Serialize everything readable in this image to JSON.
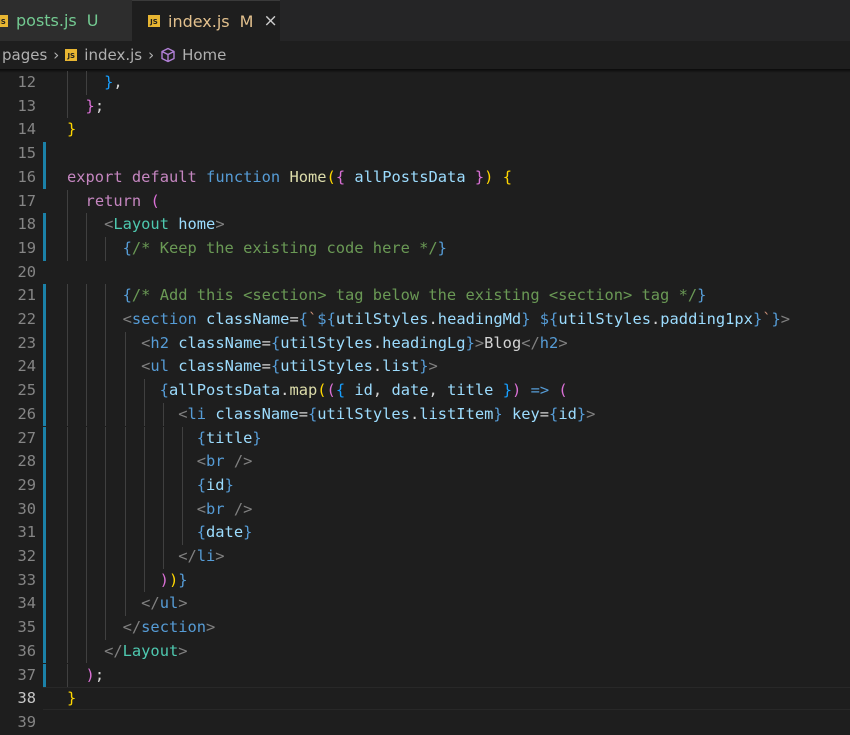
{
  "tabs": [
    {
      "label": "posts.js",
      "status": "U",
      "active": false
    },
    {
      "label": "index.js",
      "status": "M",
      "active": true
    }
  ],
  "breadcrumb": {
    "folder": "pages",
    "file": "index.js",
    "symbol": "Home"
  },
  "icons": {
    "file_badge": "JS",
    "close": "×",
    "chevron": "›"
  },
  "colors": {
    "git_untracked": "#73c991",
    "git_modified": "#e2c08d",
    "modified_gutter": "#1b81a8"
  },
  "editor": {
    "active_line": 38,
    "lines": [
      {
        "n": "12",
        "modified": false
      },
      {
        "n": "13",
        "modified": false
      },
      {
        "n": "14",
        "modified": false
      },
      {
        "n": "15",
        "modified": true
      },
      {
        "n": "16",
        "modified": true
      },
      {
        "n": "17",
        "modified": false
      },
      {
        "n": "18",
        "modified": true
      },
      {
        "n": "19",
        "modified": true
      },
      {
        "n": "20",
        "modified": false
      },
      {
        "n": "21",
        "modified": true
      },
      {
        "n": "22",
        "modified": true
      },
      {
        "n": "23",
        "modified": true
      },
      {
        "n": "24",
        "modified": true
      },
      {
        "n": "25",
        "modified": true
      },
      {
        "n": "26",
        "modified": true
      },
      {
        "n": "27",
        "modified": true
      },
      {
        "n": "28",
        "modified": true
      },
      {
        "n": "29",
        "modified": true
      },
      {
        "n": "30",
        "modified": true
      },
      {
        "n": "31",
        "modified": true
      },
      {
        "n": "32",
        "modified": true
      },
      {
        "n": "33",
        "modified": true
      },
      {
        "n": "34",
        "modified": true
      },
      {
        "n": "35",
        "modified": true
      },
      {
        "n": "36",
        "modified": true
      },
      {
        "n": "37",
        "modified": true
      },
      {
        "n": "38",
        "modified": false
      },
      {
        "n": "39",
        "modified": false
      }
    ],
    "code": [
      [
        [
          "p",
          "    "
        ],
        [
          "b3",
          "}"
        ],
        [
          "p",
          ","
        ]
      ],
      [
        [
          "p",
          "  "
        ],
        [
          "b2",
          "}"
        ],
        [
          "p",
          ";"
        ]
      ],
      [
        [
          "b1",
          "}"
        ]
      ],
      [],
      [
        [
          "kc",
          "export"
        ],
        [
          "p",
          " "
        ],
        [
          "kc",
          "default"
        ],
        [
          "p",
          " "
        ],
        [
          "k",
          "function"
        ],
        [
          "p",
          " "
        ],
        [
          "f",
          "Home"
        ],
        [
          "b1",
          "("
        ],
        [
          "b2",
          "{"
        ],
        [
          "p",
          " "
        ],
        [
          "v",
          "allPostsData"
        ],
        [
          "p",
          " "
        ],
        [
          "b2",
          "}"
        ],
        [
          "b1",
          ")"
        ],
        [
          "p",
          " "
        ],
        [
          "b1",
          "{"
        ]
      ],
      [
        [
          "p",
          "  "
        ],
        [
          "kc",
          "return"
        ],
        [
          "p",
          " "
        ],
        [
          "b2",
          "("
        ]
      ],
      [
        [
          "p",
          "    "
        ],
        [
          "t",
          "<"
        ],
        [
          "cmp",
          "Layout"
        ],
        [
          "p",
          " "
        ],
        [
          "a",
          "home"
        ],
        [
          "t",
          ">"
        ]
      ],
      [
        [
          "p",
          "      "
        ],
        [
          "k",
          "{"
        ],
        [
          "c",
          "/* Keep the existing code here */"
        ],
        [
          "k",
          "}"
        ]
      ],
      [],
      [
        [
          "p",
          "      "
        ],
        [
          "k",
          "{"
        ],
        [
          "c",
          "/* Add this <section> tag below the existing <section> tag */"
        ],
        [
          "k",
          "}"
        ]
      ],
      [
        [
          "p",
          "      "
        ],
        [
          "t",
          "<"
        ],
        [
          "tn",
          "section"
        ],
        [
          "p",
          " "
        ],
        [
          "a",
          "className"
        ],
        [
          "p",
          "="
        ],
        [
          "k",
          "{"
        ],
        [
          "s",
          "`"
        ],
        [
          "k",
          "${"
        ],
        [
          "v",
          "utilStyles"
        ],
        [
          "p",
          "."
        ],
        [
          "v",
          "headingMd"
        ],
        [
          "k",
          "}"
        ],
        [
          "s",
          " "
        ],
        [
          "k",
          "${"
        ],
        [
          "v",
          "utilStyles"
        ],
        [
          "p",
          "."
        ],
        [
          "v",
          "padding1px"
        ],
        [
          "k",
          "}"
        ],
        [
          "s",
          "`"
        ],
        [
          "k",
          "}"
        ],
        [
          "t",
          ">"
        ]
      ],
      [
        [
          "p",
          "        "
        ],
        [
          "t",
          "<"
        ],
        [
          "tn",
          "h2"
        ],
        [
          "p",
          " "
        ],
        [
          "a",
          "className"
        ],
        [
          "p",
          "="
        ],
        [
          "k",
          "{"
        ],
        [
          "v",
          "utilStyles"
        ],
        [
          "p",
          "."
        ],
        [
          "v",
          "headingLg"
        ],
        [
          "k",
          "}"
        ],
        [
          "t",
          ">"
        ],
        [
          "p",
          "Blog"
        ],
        [
          "t",
          "</"
        ],
        [
          "tn",
          "h2"
        ],
        [
          "t",
          ">"
        ]
      ],
      [
        [
          "p",
          "        "
        ],
        [
          "t",
          "<"
        ],
        [
          "tn",
          "ul"
        ],
        [
          "p",
          " "
        ],
        [
          "a",
          "className"
        ],
        [
          "p",
          "="
        ],
        [
          "k",
          "{"
        ],
        [
          "v",
          "utilStyles"
        ],
        [
          "p",
          "."
        ],
        [
          "v",
          "list"
        ],
        [
          "k",
          "}"
        ],
        [
          "t",
          ">"
        ]
      ],
      [
        [
          "p",
          "          "
        ],
        [
          "k",
          "{"
        ],
        [
          "v",
          "allPostsData"
        ],
        [
          "p",
          "."
        ],
        [
          "f",
          "map"
        ],
        [
          "b1",
          "("
        ],
        [
          "b2",
          "("
        ],
        [
          "b3",
          "{"
        ],
        [
          "p",
          " "
        ],
        [
          "v",
          "id"
        ],
        [
          "p",
          ", "
        ],
        [
          "v",
          "date"
        ],
        [
          "p",
          ", "
        ],
        [
          "v",
          "title"
        ],
        [
          "p",
          " "
        ],
        [
          "b3",
          "}"
        ],
        [
          "b2",
          ")"
        ],
        [
          "p",
          " "
        ],
        [
          "k",
          "=>"
        ],
        [
          "p",
          " "
        ],
        [
          "b2",
          "("
        ]
      ],
      [
        [
          "p",
          "            "
        ],
        [
          "t",
          "<"
        ],
        [
          "tn",
          "li"
        ],
        [
          "p",
          " "
        ],
        [
          "a",
          "className"
        ],
        [
          "p",
          "="
        ],
        [
          "k",
          "{"
        ],
        [
          "v",
          "utilStyles"
        ],
        [
          "p",
          "."
        ],
        [
          "v",
          "listItem"
        ],
        [
          "k",
          "}"
        ],
        [
          "p",
          " "
        ],
        [
          "a",
          "key"
        ],
        [
          "p",
          "="
        ],
        [
          "k",
          "{"
        ],
        [
          "v",
          "id"
        ],
        [
          "k",
          "}"
        ],
        [
          "t",
          ">"
        ]
      ],
      [
        [
          "p",
          "              "
        ],
        [
          "k",
          "{"
        ],
        [
          "v",
          "title"
        ],
        [
          "k",
          "}"
        ]
      ],
      [
        [
          "p",
          "              "
        ],
        [
          "t",
          "<"
        ],
        [
          "tn",
          "br"
        ],
        [
          "p",
          " "
        ],
        [
          "t",
          "/>"
        ]
      ],
      [
        [
          "p",
          "              "
        ],
        [
          "k",
          "{"
        ],
        [
          "v",
          "id"
        ],
        [
          "k",
          "}"
        ]
      ],
      [
        [
          "p",
          "              "
        ],
        [
          "t",
          "<"
        ],
        [
          "tn",
          "br"
        ],
        [
          "p",
          " "
        ],
        [
          "t",
          "/>"
        ]
      ],
      [
        [
          "p",
          "              "
        ],
        [
          "k",
          "{"
        ],
        [
          "v",
          "date"
        ],
        [
          "k",
          "}"
        ]
      ],
      [
        [
          "p",
          "            "
        ],
        [
          "t",
          "</"
        ],
        [
          "tn",
          "li"
        ],
        [
          "t",
          ">"
        ]
      ],
      [
        [
          "p",
          "          "
        ],
        [
          "b2",
          ")"
        ],
        [
          "b1",
          ")"
        ],
        [
          "k",
          "}"
        ]
      ],
      [
        [
          "p",
          "        "
        ],
        [
          "t",
          "</"
        ],
        [
          "tn",
          "ul"
        ],
        [
          "t",
          ">"
        ]
      ],
      [
        [
          "p",
          "      "
        ],
        [
          "t",
          "</"
        ],
        [
          "tn",
          "section"
        ],
        [
          "t",
          ">"
        ]
      ],
      [
        [
          "p",
          "    "
        ],
        [
          "t",
          "</"
        ],
        [
          "cmp",
          "Layout"
        ],
        [
          "t",
          ">"
        ]
      ],
      [
        [
          "p",
          "  "
        ],
        [
          "b2",
          ")"
        ],
        [
          "p",
          ";"
        ]
      ],
      [
        [
          "b1",
          "}"
        ]
      ],
      []
    ]
  }
}
